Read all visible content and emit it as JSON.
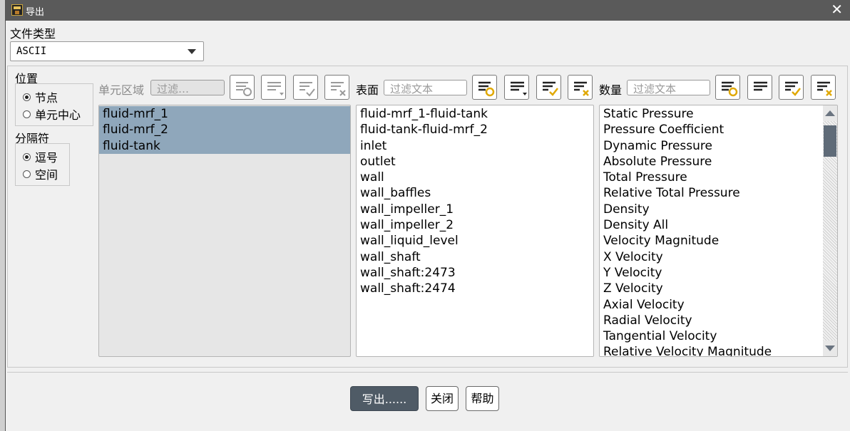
{
  "window": {
    "title": "导出"
  },
  "file_type": {
    "label": "文件类型",
    "value": "ASCII"
  },
  "location": {
    "label": "位置",
    "options": [
      {
        "label": "节点",
        "selected": true
      },
      {
        "label": "单元中心",
        "selected": false
      }
    ]
  },
  "delimiter": {
    "label": "分隔符",
    "options": [
      {
        "label": "逗号",
        "selected": true
      },
      {
        "label": "空间",
        "selected": false
      }
    ]
  },
  "cell_zones": {
    "label": "单元区域",
    "filter_placeholder": "过滤…",
    "items": [
      "fluid-mrf_1",
      "fluid-mrf_2",
      "fluid-tank"
    ],
    "selected": [
      0,
      1,
      2
    ]
  },
  "surfaces": {
    "label": "表面",
    "filter_placeholder": "过滤文本",
    "items": [
      "fluid-mrf_1-fluid-tank",
      "fluid-tank-fluid-mrf_2",
      "inlet",
      "outlet",
      "wall",
      "wall_baffles",
      "wall_impeller_1",
      "wall_impeller_2",
      "wall_liquid_level",
      "wall_shaft",
      "wall_shaft:2473",
      "wall_shaft:2474"
    ]
  },
  "quantities": {
    "label": "数量",
    "filter_placeholder": "过滤文本",
    "items": [
      "Static Pressure",
      "Pressure Coefficient",
      "Dynamic Pressure",
      "Absolute Pressure",
      "Total Pressure",
      "Relative Total Pressure",
      "Density",
      "Density All",
      "Velocity Magnitude",
      "X Velocity",
      "Y Velocity",
      "Z Velocity",
      "Axial Velocity",
      "Radial Velocity",
      "Tangential Velocity",
      "Relative Velocity Magnitude"
    ]
  },
  "buttons": {
    "write": "写出......",
    "close": "关闭",
    "help": "帮助"
  },
  "colors": {
    "selection": "#8fa7bb",
    "accent_yellow": "#e0a800",
    "titlebar": "#5a5a5a",
    "primary_button": "#4f5b66"
  }
}
